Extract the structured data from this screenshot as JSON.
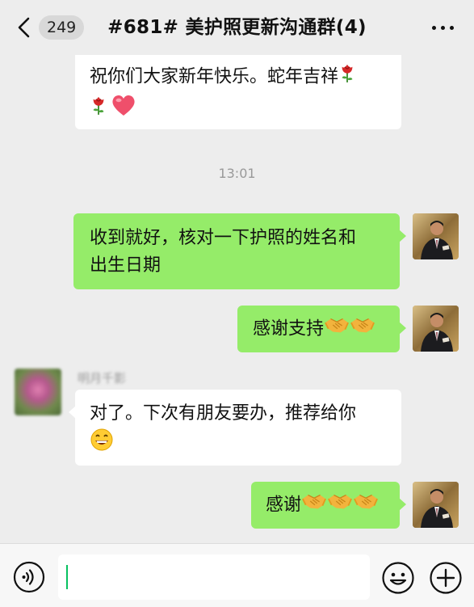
{
  "header": {
    "unread_count": "249",
    "title": "#681# 美护照更新沟通群(4)"
  },
  "messages": [
    {
      "id": "m1",
      "direction": "incoming",
      "text": "祝你们大家新年快乐。蛇年吉祥",
      "emojis": [
        "rose",
        "rose",
        "heart"
      ]
    },
    {
      "id": "ts",
      "timestamp": "13:01"
    },
    {
      "id": "m2",
      "direction": "outgoing",
      "lines": [
        "收到就好，核对一下护照的姓名和",
        "出生日期"
      ]
    },
    {
      "id": "m3",
      "direction": "outgoing",
      "text": "感谢支持",
      "emojis": [
        "handshake",
        "handshake"
      ]
    },
    {
      "id": "m4",
      "direction": "incoming",
      "sender": "明月千影",
      "lines": [
        "对了。下次有朋友要办，推荐给你"
      ],
      "emojis": [
        "grin"
      ]
    },
    {
      "id": "m5",
      "direction": "outgoing",
      "text": "感谢",
      "emojis": [
        "handshake",
        "handshake",
        "handshake"
      ]
    }
  ],
  "input": {
    "value": "",
    "placeholder": ""
  },
  "colors": {
    "background": "#ededed",
    "outgoing_bubble": "#95ec69",
    "incoming_bubble": "#ffffff",
    "caret": "#07c160"
  },
  "icons": [
    "back-icon",
    "more-icon",
    "voice-icon",
    "emoji-icon",
    "plus-icon"
  ]
}
